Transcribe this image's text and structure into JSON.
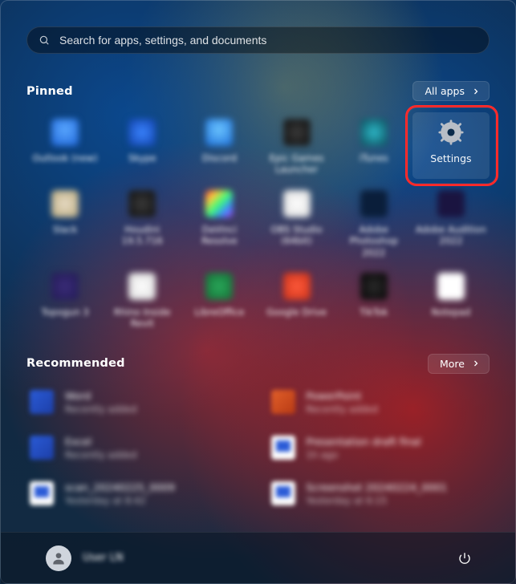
{
  "search": {
    "placeholder": "Search for apps, settings, and documents"
  },
  "pinned": {
    "heading": "Pinned",
    "all_apps_label": "All apps",
    "apps": [
      {
        "label": "Outlook (new)",
        "icon": "ico-blue"
      },
      {
        "label": "Skype",
        "icon": "ico-blue2"
      },
      {
        "label": "Discord",
        "icon": "ico-blue3"
      },
      {
        "label": "Epic Games Launcher",
        "icon": "ico-dark"
      },
      {
        "label": "iTunes",
        "icon": "ico-cyan"
      },
      {
        "label": "Settings",
        "icon": "settings",
        "is_settings": true
      },
      {
        "label": "Slack",
        "icon": "ico-beige"
      },
      {
        "label": "Houdini 19.5.716",
        "icon": "ico-dark"
      },
      {
        "label": "DaVinci Resolve",
        "icon": "ico-rainbow"
      },
      {
        "label": "OBS Studio (64bit)",
        "icon": "ico-white"
      },
      {
        "label": "Adobe Photoshop 2022",
        "icon": "ico-ps"
      },
      {
        "label": "Adobe Audition 2022",
        "icon": "ico-ae"
      },
      {
        "label": "Topogun 3",
        "icon": "ico-purple"
      },
      {
        "label": "Rhino Inside Revit",
        "icon": "ico-white"
      },
      {
        "label": "LibreOffice",
        "icon": "ico-green"
      },
      {
        "label": "Google Drive",
        "icon": "ico-red"
      },
      {
        "label": "TikTok",
        "icon": "ico-black"
      },
      {
        "label": "Notepad",
        "icon": "ico-whitesq"
      }
    ]
  },
  "recommended": {
    "heading": "Recommended",
    "more_label": "More",
    "items": [
      {
        "title": "Word",
        "subtitle": "Recently added",
        "icon": "rico-word"
      },
      {
        "title": "PowerPoint",
        "subtitle": "Recently added",
        "icon": "rico-ppt"
      },
      {
        "title": "Excel",
        "subtitle": "Recently added",
        "icon": "rico-word"
      },
      {
        "title": "Presentation draft final",
        "subtitle": "1h ago",
        "icon": "rico-doc"
      },
      {
        "title": "scan_20240225_0009",
        "subtitle": "Yesterday at 8:42",
        "icon": "rico-doc"
      },
      {
        "title": "Screenshot 20240224_0001",
        "subtitle": "Yesterday at 6:15",
        "icon": "rico-doc"
      }
    ]
  },
  "footer": {
    "username": "User LN"
  },
  "highlight_target": "settings-app"
}
